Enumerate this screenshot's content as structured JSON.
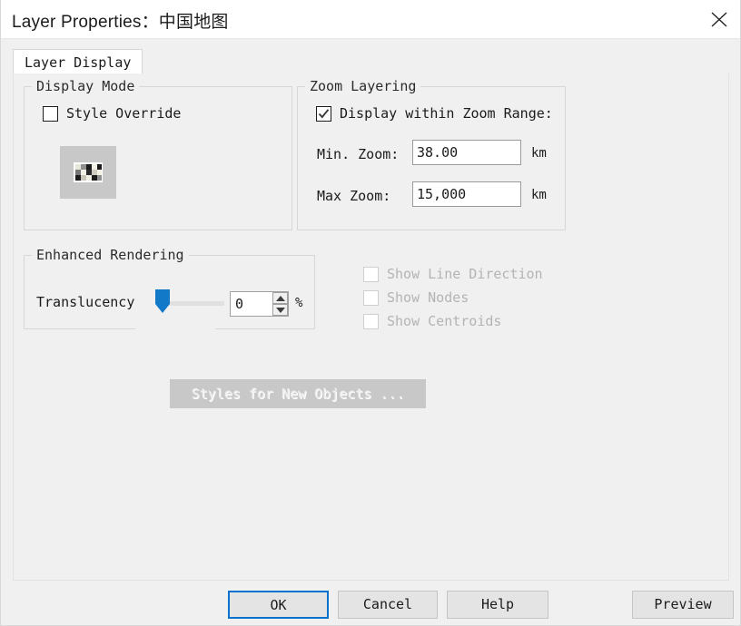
{
  "window": {
    "title": "Layer Properties：中国地图",
    "close_icon": "close-icon"
  },
  "tabs": [
    {
      "label": "Layer Display",
      "selected": true
    }
  ],
  "display_mode": {
    "group_title": "Display Mode",
    "style_override": {
      "label": "Style Override",
      "checked": false
    },
    "style_preview_button": {
      "name": "style-preview-button",
      "enabled": false,
      "swatch": "checkerboard-pattern"
    }
  },
  "zoom_layering": {
    "group_title": "Zoom Layering",
    "display_within_zoom_range": {
      "label": "Display within Zoom Range:",
      "checked": true
    },
    "min_zoom": {
      "label": "Min. Zoom:",
      "value": "38.00",
      "unit": "km"
    },
    "max_zoom": {
      "label": "Max Zoom:",
      "value": "15,000",
      "unit": "km"
    }
  },
  "enhanced_rendering": {
    "group_title": "Enhanced Rendering",
    "translucency": {
      "label": "Translucency",
      "value": "0",
      "unit": "%",
      "slider_percent": 0,
      "spin_up_icon": "chevron-up-icon",
      "spin_down_icon": "chevron-down-icon"
    }
  },
  "render_options": [
    {
      "label": "Show Line Direction",
      "checked": false,
      "enabled": false
    },
    {
      "label": "Show Nodes",
      "checked": false,
      "enabled": false
    },
    {
      "label": "Show Centroids",
      "checked": false,
      "enabled": false
    }
  ],
  "styles_new_objects_button": {
    "label": "Styles for New Objects ...",
    "enabled": false
  },
  "footer": {
    "ok": "OK",
    "cancel": "Cancel",
    "help": "Help",
    "preview": "Preview"
  },
  "colors": {
    "accent": "#0a72cd",
    "dialog_bg": "#f0f0f0",
    "titlebar_bg": "#ffffff",
    "field_bg": "#ffffff",
    "disabled_text": "#b4b4b4"
  }
}
